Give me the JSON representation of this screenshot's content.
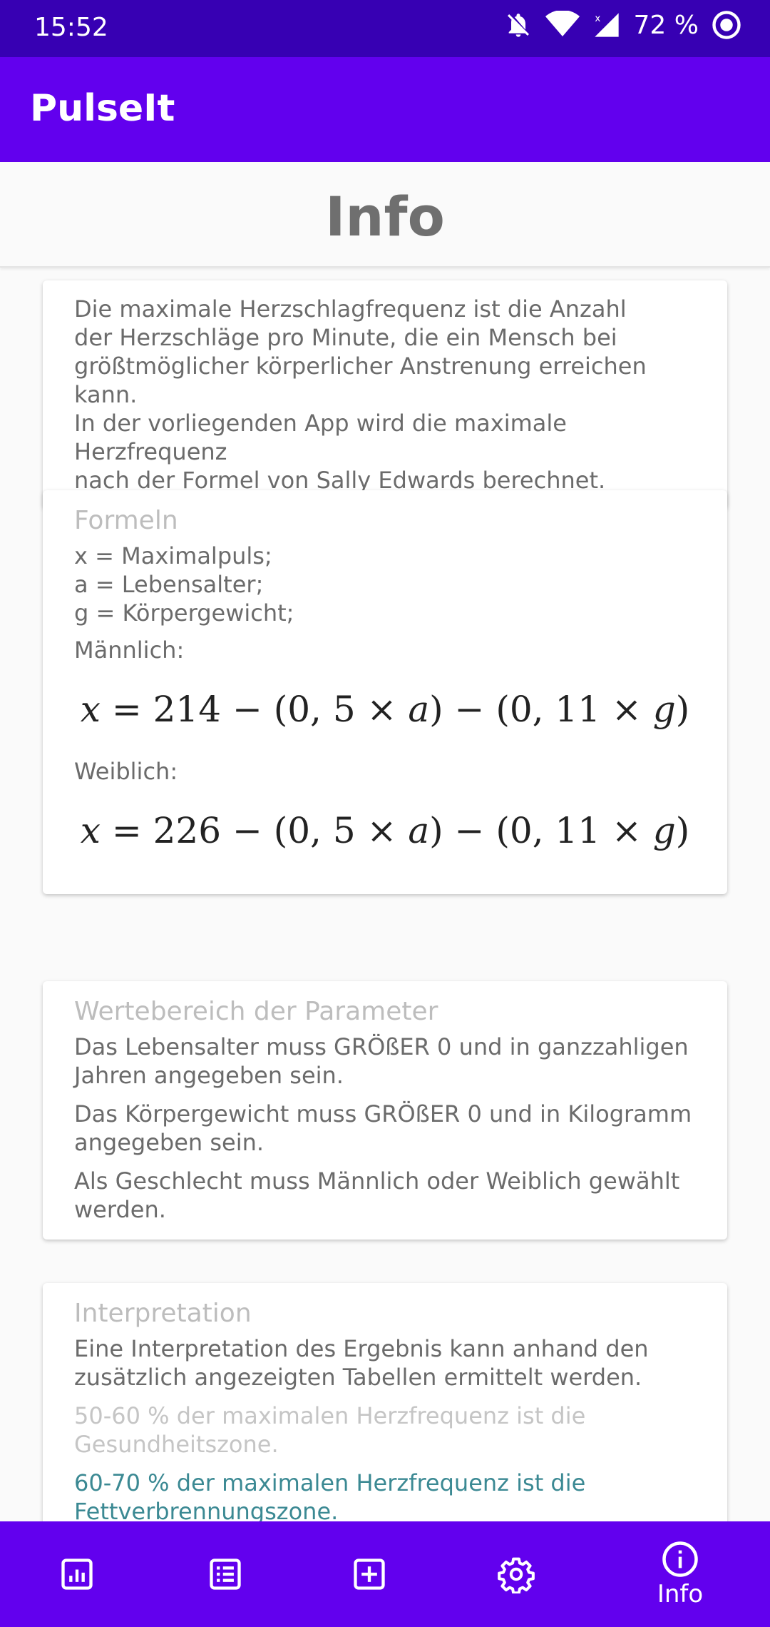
{
  "status": {
    "time": "15:52",
    "battery": "72 %"
  },
  "app": {
    "title": "PulseIt"
  },
  "page": {
    "title": "Info"
  },
  "intro": {
    "lines": [
      "Die maximale Herzschlagfrequenz ist die Anzahl",
      "der Herzschläge pro Minute, die ein Mensch bei",
      "größtmöglicher körperlicher Anstrenung erreichen kann.",
      "In der vorliegenden App wird die maximale Herzfrequenz",
      "nach der Formel von Sally Edwards berechnet."
    ]
  },
  "formulas": {
    "heading": "Formeln",
    "defs": [
      "x = Maximalpuls;",
      "a = Lebensalter;",
      "g = Körpergewicht;"
    ],
    "male_label": "Männlich:",
    "male_formula": "214",
    "female_label": "Weiblich:",
    "female_formula": "226"
  },
  "range": {
    "heading": "Wertebereich der Parameter",
    "p1": [
      "Das Lebensalter muss GRÖßER 0 und in ganzzahligen",
      "Jahren angegeben sein."
    ],
    "p2": [
      "Das Körpergewicht muss GRÖßER 0 und in Kilogramm",
      "angegeben sein."
    ],
    "p3": [
      "Als Geschlecht muss Männlich oder Weiblich gewählt",
      "werden."
    ]
  },
  "interpretation": {
    "heading": "Interpretation",
    "p1": [
      "Eine Interpretation des Ergebnis kann anhand den",
      "zusätzlich angezeigten Tabellen ermittelt werden."
    ],
    "p2": [
      "50-60 % der maximalen Herzfrequenz ist die",
      "Gesundheitszone."
    ],
    "p3": [
      "60-70 % der maximalen Herzfrequenz ist die",
      "Fettverbrennungszone."
    ],
    "colors": {
      "health": "#c5c5c5",
      "fat": "#3b8993"
    }
  },
  "nav": {
    "items": [
      {
        "icon": "chart-icon"
      },
      {
        "icon": "list-icon"
      },
      {
        "icon": "add-box-icon"
      },
      {
        "icon": "settings-icon"
      },
      {
        "icon": "info-icon",
        "label": "Info"
      }
    ]
  },
  "colors": {
    "primary": "#6200ee",
    "primary_dark": "#3700b3"
  }
}
